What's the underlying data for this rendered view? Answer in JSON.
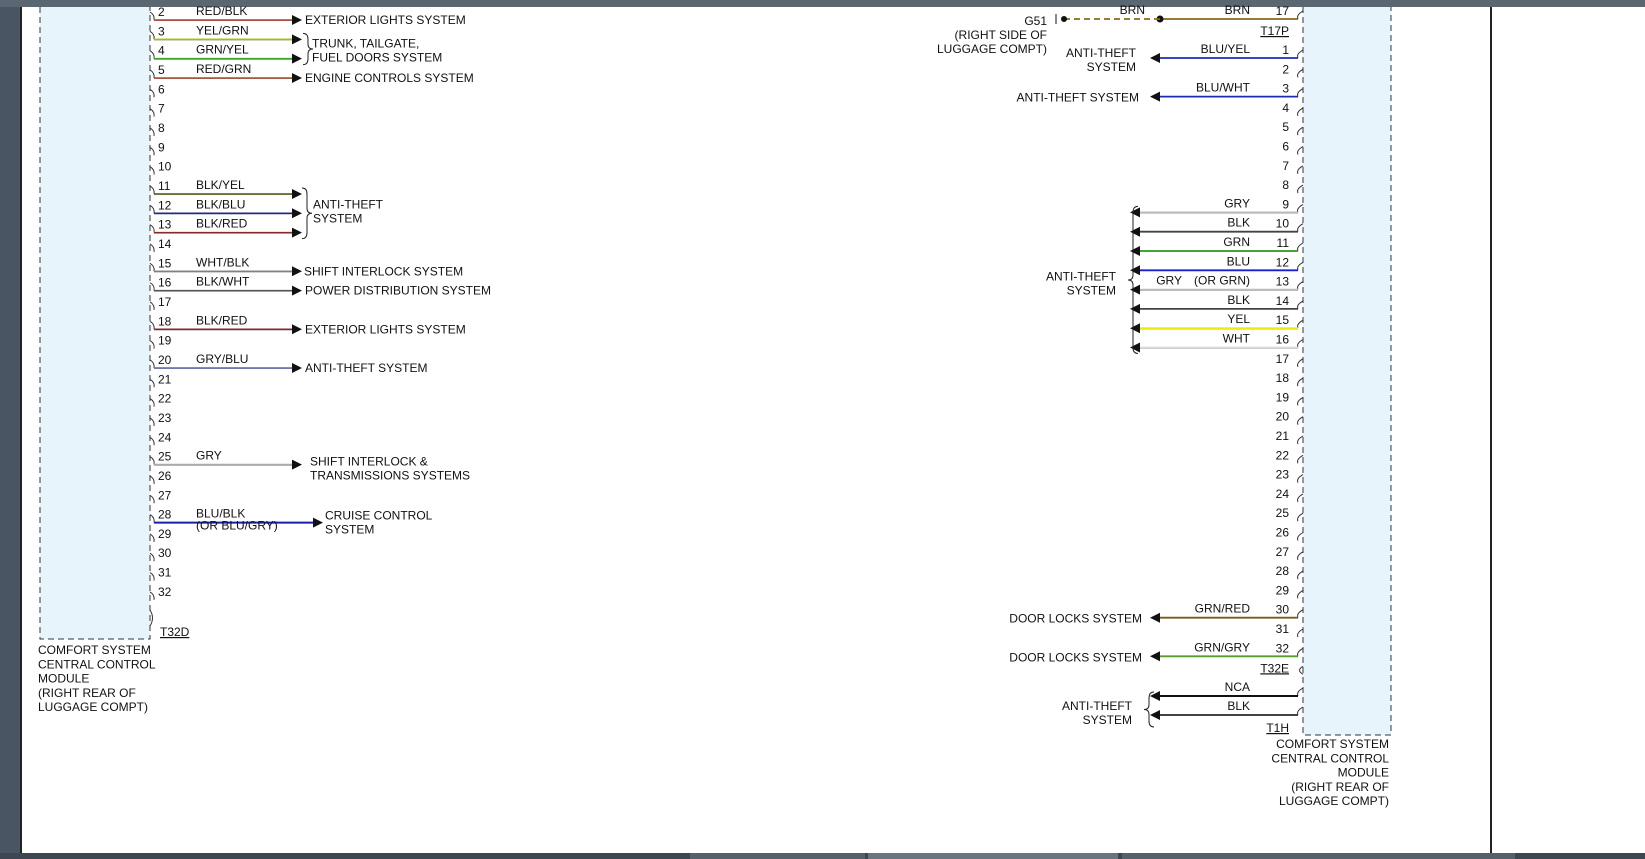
{
  "left_module": {
    "connector": "T32D",
    "caption": [
      "COMFORT SYSTEM",
      "CENTRAL CONTROL",
      "MODULE",
      "(RIGHT REAR OF",
      "LUGGAGE COMPT)"
    ],
    "pins": [
      {
        "pin": "2",
        "wire": "RED/BLK",
        "color": "#c0392b",
        "arrow": true
      },
      {
        "pin": "3",
        "wire": "YEL/GRN",
        "color": "#b5c400",
        "arrow": true
      },
      {
        "pin": "4",
        "wire": "GRN/YEL",
        "color": "#3aa52a",
        "arrow": true
      },
      {
        "pin": "5",
        "wire": "RED/GRN",
        "color": "#b5491e",
        "arrow": true
      },
      {
        "pin": "6"
      },
      {
        "pin": "7"
      },
      {
        "pin": "8"
      },
      {
        "pin": "9"
      },
      {
        "pin": "10"
      },
      {
        "pin": "11",
        "wire": "BLK/YEL",
        "color": "#6b6a1a",
        "arrow": true
      },
      {
        "pin": "12",
        "wire": "BLK/BLU",
        "color": "#1f2a8a",
        "arrow": true
      },
      {
        "pin": "13",
        "wire": "BLK/RED",
        "color": "#8a2a2a",
        "arrow": true
      },
      {
        "pin": "14"
      },
      {
        "pin": "15",
        "wire": "WHT/BLK",
        "color": "#888888",
        "arrow": true
      },
      {
        "pin": "16",
        "wire": "BLK/WHT",
        "color": "#555555",
        "arrow": true
      },
      {
        "pin": "17"
      },
      {
        "pin": "18",
        "wire": "BLK/RED",
        "color": "#8a2a2a",
        "arrow": true
      },
      {
        "pin": "19"
      },
      {
        "pin": "20",
        "wire": "GRY/BLU",
        "color": "#6e78c8",
        "arrow": true
      },
      {
        "pin": "21"
      },
      {
        "pin": "22"
      },
      {
        "pin": "23"
      },
      {
        "pin": "24"
      },
      {
        "pin": "25",
        "wire": "GRY",
        "color": "#aaaaaa",
        "arrow": true
      },
      {
        "pin": "26"
      },
      {
        "pin": "27"
      },
      {
        "pin": "28",
        "wire": "BLU/BLK",
        "wire2": "(OR BLU/GRY)",
        "color": "#1a1fa8",
        "arrow": true
      },
      {
        "pin": "29"
      },
      {
        "pin": "30"
      },
      {
        "pin": "31"
      },
      {
        "pin": "32"
      }
    ],
    "systems": [
      {
        "text": [
          "EXTERIOR LIGHTS SYSTEM"
        ],
        "pin": "2"
      },
      {
        "text": [
          "TRUNK, TAILGATE,",
          "FUEL DOORS SYSTEM"
        ],
        "pin": "3"
      },
      {
        "text": [
          "ENGINE CONTROLS SYSTEM"
        ],
        "pin": "5"
      },
      {
        "text": [
          "ANTI-THEFT",
          "SYSTEM"
        ],
        "pin": "11"
      },
      {
        "text": [
          "SHIFT INTERLOCK SYSTEM"
        ],
        "pin": "15"
      },
      {
        "text": [
          "POWER DISTRIBUTION SYSTEM"
        ],
        "pin": "16"
      },
      {
        "text": [
          "EXTERIOR LIGHTS SYSTEM"
        ],
        "pin": "18"
      },
      {
        "text": [
          "ANTI-THEFT SYSTEM"
        ],
        "pin": "20"
      },
      {
        "text": [
          "SHIFT INTERLOCK &",
          "TRANSMISSIONS SYSTEMS"
        ],
        "pin": "25"
      },
      {
        "text": [
          "CRUISE CONTROL",
          "SYSTEM"
        ],
        "pin": "28"
      }
    ]
  },
  "right_module": {
    "caption": [
      "COMFORT SYSTEM",
      "CENTRAL CONTROL",
      "MODULE",
      "(RIGHT REAR OF",
      "LUGGAGE COMPT)"
    ],
    "t17p": {
      "connector": "T17P",
      "pin": "17",
      "wire": "BRN",
      "color": "#8a6a1a",
      "ground": "G51",
      "ground_note": [
        "(RIGHT SIDE OF",
        "LUGGAGE COMPT)"
      ],
      "dashed_wire": "BRN"
    },
    "t32e": {
      "connector": "T32E",
      "pins": [
        {
          "pin": "1",
          "wire": "BLU/YEL",
          "color": "#1f2ab0",
          "arrow": true
        },
        {
          "pin": "2"
        },
        {
          "pin": "3",
          "wire": "BLU/WHT",
          "color": "#1f2ab0",
          "arrow": true
        },
        {
          "pin": "4"
        },
        {
          "pin": "5"
        },
        {
          "pin": "6"
        },
        {
          "pin": "7"
        },
        {
          "pin": "8"
        },
        {
          "pin": "9",
          "wire": "GRY",
          "color": "#bbbbbb",
          "arrow": true
        },
        {
          "pin": "10",
          "wire": "BLK",
          "color": "#444444",
          "arrow": true
        },
        {
          "pin": "11",
          "wire": "GRN",
          "color": "#2a9a1a",
          "arrow": true
        },
        {
          "pin": "12",
          "wire": "BLU",
          "color": "#1a1fd0",
          "arrow": true
        },
        {
          "pin": "13",
          "wire": "GRY",
          "wire2": "(OR GRN)",
          "color": "#bbbbbb",
          "arrow": true
        },
        {
          "pin": "14",
          "wire": "BLK",
          "color": "#444444",
          "arrow": true
        },
        {
          "pin": "15",
          "wire": "YEL",
          "color": "#f0f000",
          "arrow": true
        },
        {
          "pin": "16",
          "wire": "WHT",
          "color": "#dddddd",
          "arrow": true
        },
        {
          "pin": "17"
        },
        {
          "pin": "18"
        },
        {
          "pin": "19"
        },
        {
          "pin": "20"
        },
        {
          "pin": "21"
        },
        {
          "pin": "22"
        },
        {
          "pin": "23"
        },
        {
          "pin": "24"
        },
        {
          "pin": "25"
        },
        {
          "pin": "26"
        },
        {
          "pin": "27"
        },
        {
          "pin": "28"
        },
        {
          "pin": "29"
        },
        {
          "pin": "30",
          "wire": "GRN/RED",
          "color": "#7a5a1a",
          "arrow": true
        },
        {
          "pin": "31"
        },
        {
          "pin": "32",
          "wire": "GRN/GRY",
          "color": "#5a9a2a",
          "arrow": true
        }
      ],
      "systems": [
        {
          "text": [
            "ANTI-THEFT",
            "SYSTEM"
          ],
          "pin": "1"
        },
        {
          "text": [
            "ANTI-THEFT SYSTEM"
          ],
          "pin": "3"
        },
        {
          "text": [
            "ANTI-THEFT",
            "SYSTEM"
          ],
          "pin": "12"
        },
        {
          "text": [
            "DOOR LOCKS SYSTEM"
          ],
          "pin": "30"
        },
        {
          "text": [
            "DOOR LOCKS SYSTEM"
          ],
          "pin": "32"
        }
      ]
    },
    "t1h": {
      "connector": "T1H",
      "wires": [
        {
          "wire": "NCA",
          "color": "#111111"
        },
        {
          "wire": "BLK",
          "color": "#444444"
        }
      ],
      "system": [
        "ANTI-THEFT",
        "SYSTEM"
      ]
    }
  }
}
